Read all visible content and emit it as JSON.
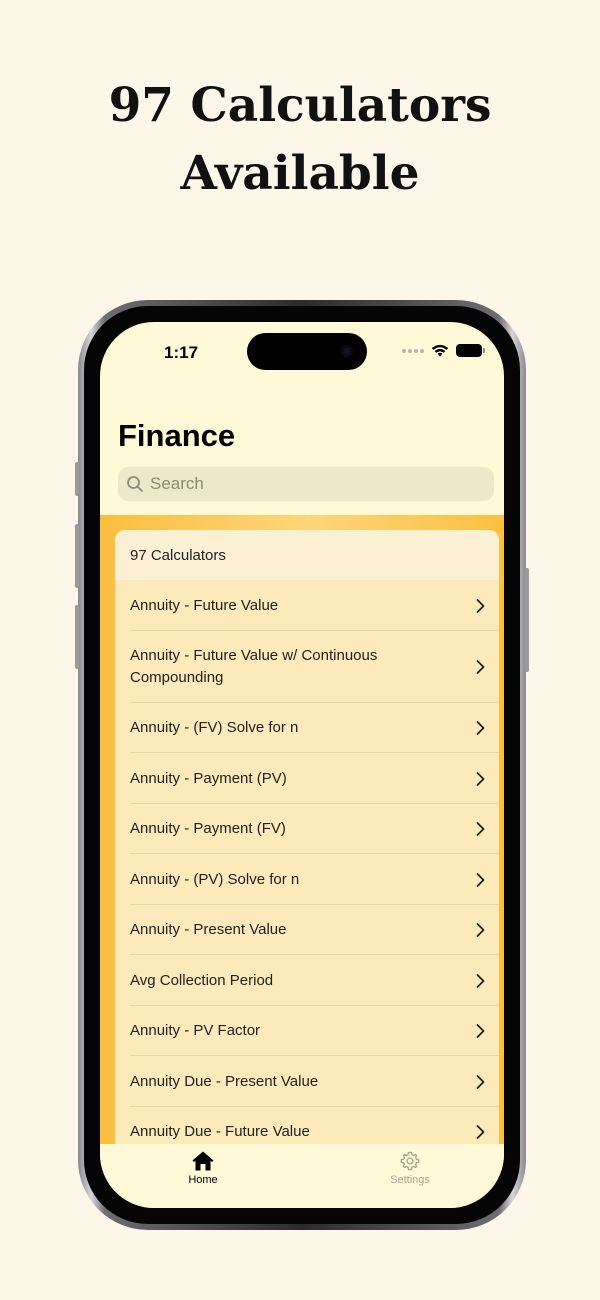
{
  "headline": {
    "line1": "97 Calculators",
    "line2": "Available"
  },
  "status_bar": {
    "time": "1:17"
  },
  "nav": {
    "title": "Finance"
  },
  "search": {
    "placeholder": "Search"
  },
  "list": {
    "header": "97 Calculators",
    "items": [
      "Annuity - Future Value",
      "Annuity - Future Value w/ Continuous Compounding",
      "Annuity - (FV) Solve for n",
      "Annuity - Payment (PV)",
      "Annuity - Payment (FV)",
      "Annuity - (PV) Solve for n",
      "Annuity - Present Value",
      "Avg Collection Period",
      "Annuity - PV Factor",
      "Annuity Due - Present Value",
      "Annuity Due - Future Value"
    ]
  },
  "tabbar": {
    "home_label": "Home",
    "settings_label": "Settings"
  }
}
